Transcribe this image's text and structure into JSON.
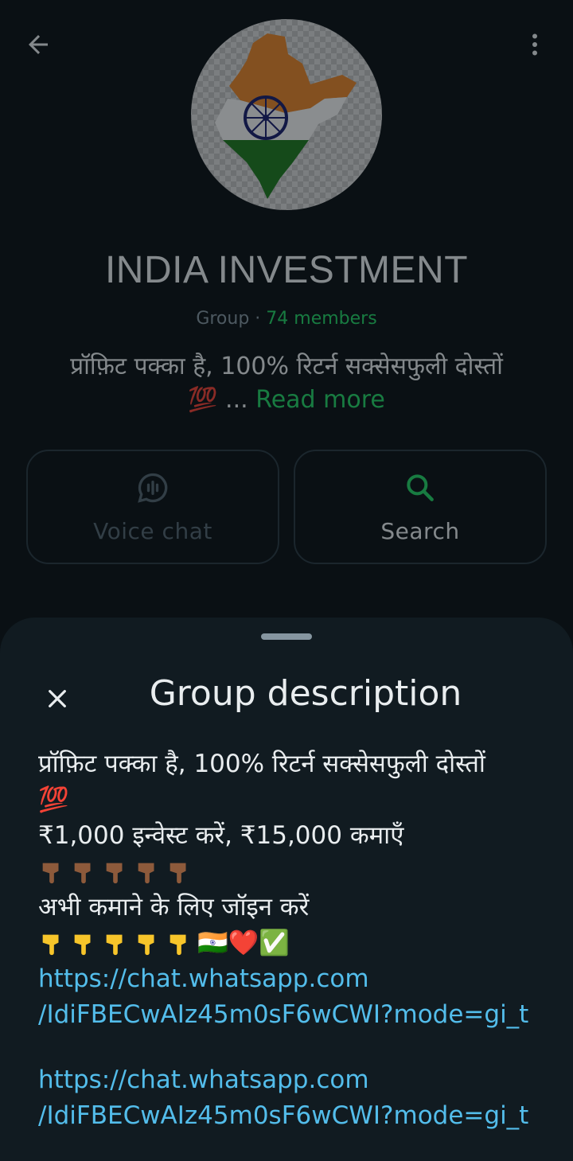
{
  "header": {
    "back_icon": "arrow-left-icon",
    "menu_icon": "more-vertical-icon"
  },
  "group": {
    "name": "INDIA INVESTMENT",
    "type_label": "Group · ",
    "members": "74 members",
    "description_preview": "प्रॉफ़िट पक्का है, 100% रिटर्न सक्सेसफुली दोस्तों",
    "preview_emoji": "💯",
    "ellipsis": " ... ",
    "read_more": "Read more"
  },
  "actions": [
    {
      "label": "Voice chat",
      "icon": "voice-chat-icon",
      "enabled": false
    },
    {
      "label": "Search",
      "icon": "search-icon",
      "enabled": true
    }
  ],
  "sheet": {
    "title": "Group description",
    "close_icon": "close-icon",
    "lines": {
      "line1": "प्रॉफ़िट पक्का है, 100% रिटर्न सक्सेसफुली दोस्तों",
      "line2": "💯",
      "line3": "₹1,000 इन्वेस्ट करें, ₹15,000 कमाएँ",
      "line5": "अभी कमाने के लिए जॉइन करें",
      "line6_suffix": "🇮🇳❤️✅"
    },
    "links": [
      {
        "line1": "https://chat.whatsapp.com",
        "line2": "/IdiFBECwAIz45m0sF6wCWI?mode=gi_t"
      },
      {
        "line1": "https://chat.whatsapp.com",
        "line2": "/IdiFBECwAIz45m0sF6wCWI?mode=gi_t"
      }
    ]
  },
  "colors": {
    "accent_green": "#25d366",
    "link_blue": "#53bdeb",
    "background": "#0b141a",
    "sheet": "#111b21"
  }
}
